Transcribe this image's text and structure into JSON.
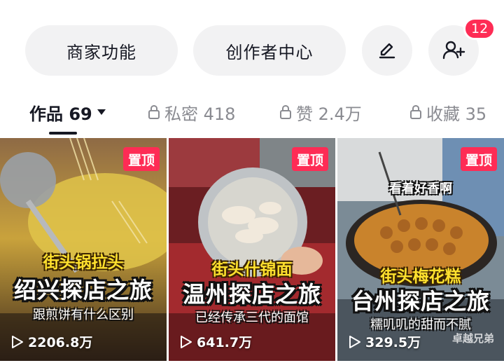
{
  "actions": {
    "merchant_label": "商家功能",
    "creator_label": "创作者中心",
    "notification_count": "12"
  },
  "tabs": [
    {
      "label": "作品 69"
    },
    {
      "label": "私密 418"
    },
    {
      "label": "赞 2.4万"
    },
    {
      "label": "收藏 35"
    }
  ],
  "videos": [
    {
      "pinned_label": "置顶",
      "caption_top": "街头锅拉头",
      "title": "绍兴探店之旅",
      "subtitle": "跟煎饼有什么区别",
      "views": "2206.8万"
    },
    {
      "pinned_label": "置顶",
      "caption_top": "街头什锦面",
      "title": "温州探店之旅",
      "subtitle": "已经传承三代的面馆",
      "views": "641.7万"
    },
    {
      "pinned_label": "置顶",
      "overlay_text": "看着好香啊",
      "caption_top": "街头梅花糕",
      "title": "台州探店之旅",
      "subtitle": "糯叽叽的甜而不腻",
      "views": "329.5万",
      "watermark": "卓越兄弟"
    }
  ],
  "colors": {
    "accent": "#fe2c55",
    "button_bg": "#f2f2f3",
    "text_primary": "#161823",
    "text_secondary": "#8a8b91"
  },
  "icons": [
    "edit-icon",
    "add-friend-icon",
    "lock-icon",
    "caret-down-icon",
    "play-icon"
  ]
}
